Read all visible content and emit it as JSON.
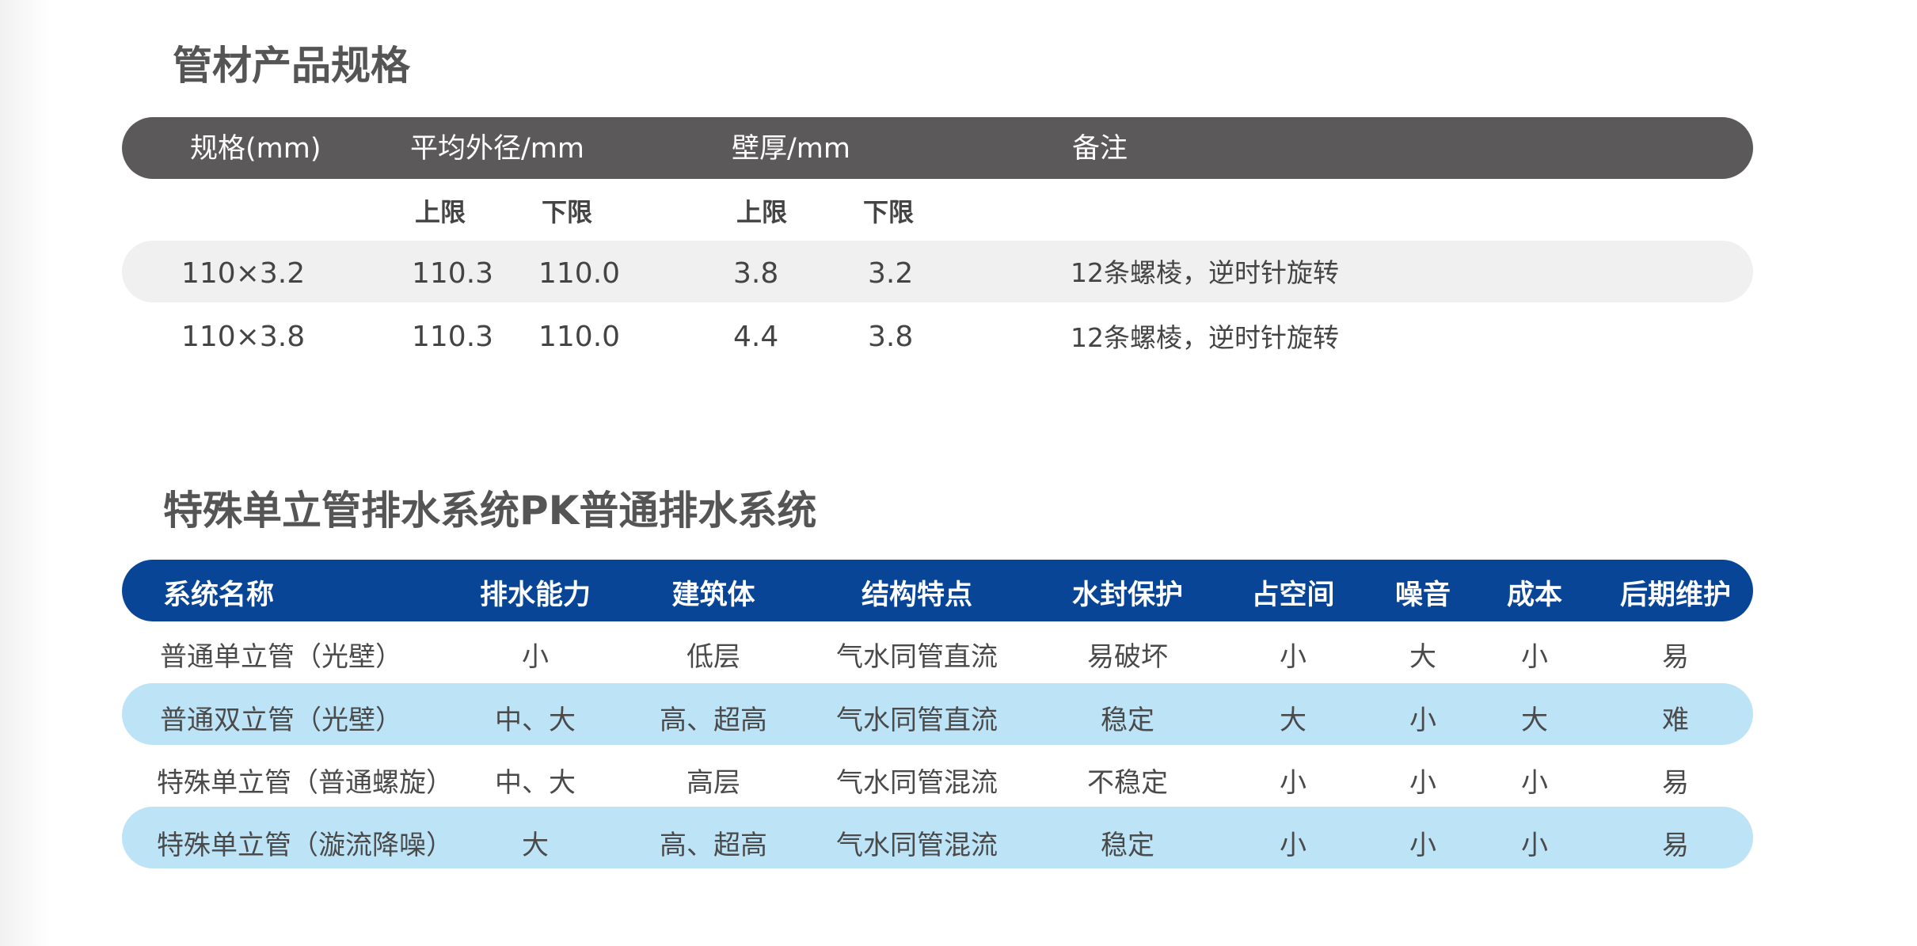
{
  "spec_section": {
    "title": "管材产品规格",
    "header": {
      "spec": "规格(mm)",
      "outer_diameter": "平均外径/mm",
      "wall": "壁厚/mm",
      "note": "备注"
    },
    "subheader": {
      "od_upper": "上限",
      "od_lower": "下限",
      "wall_upper": "上限",
      "wall_lower": "下限"
    },
    "rows": [
      {
        "spec": "110×3.2",
        "od_upper": "110.3",
        "od_lower": "110.0",
        "wall_upper": "3.8",
        "wall_lower": "3.2",
        "note": "12条螺棱，逆时针旋转"
      },
      {
        "spec": "110×3.8",
        "od_upper": "110.3",
        "od_lower": "110.0",
        "wall_upper": "4.4",
        "wall_lower": "3.8",
        "note": "12条螺棱，逆时针旋转"
      }
    ]
  },
  "compare_section": {
    "title": "特殊单立管排水系统PK普通排水系统",
    "headers": [
      "系统名称",
      "排水能力",
      "建筑体",
      "结构特点",
      "水封保护",
      "占空间",
      "噪音",
      "成本",
      "后期维护"
    ],
    "rows": [
      [
        "普通单立管（光壁）",
        "小",
        "低层",
        "气水同管直流",
        "易破坏",
        "小",
        "大",
        "小",
        "易"
      ],
      [
        "普通双立管（光壁）",
        "中、大",
        "高、超高",
        "气水同管直流",
        "稳定",
        "大",
        "小",
        "大",
        "难"
      ],
      [
        "特殊单立管（普通螺旋）",
        "中、大",
        "高层",
        "气水同管混流",
        "不稳定",
        "小",
        "小",
        "小",
        "易"
      ],
      [
        "特殊单立管（漩流降噪）",
        "大",
        "高、超高",
        "气水同管混流",
        "稳定",
        "小",
        "小",
        "小",
        "易"
      ]
    ]
  },
  "colors": {
    "spec_header_bg": "#5c595a",
    "spec_band_bg": "#f0f0f0",
    "compare_header_bg": "#084596",
    "compare_band_bg": "#bde3f7"
  }
}
